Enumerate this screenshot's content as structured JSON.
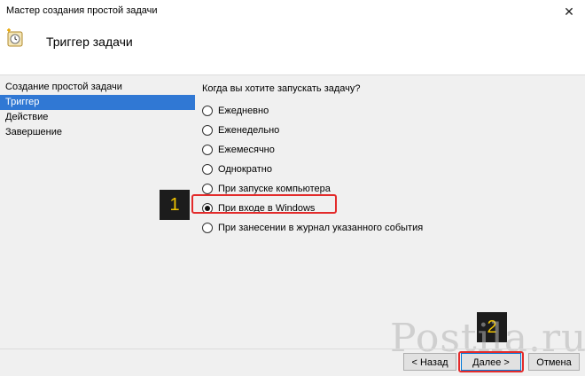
{
  "window": {
    "title": "Мастер создания простой задачи"
  },
  "header": {
    "title": "Триггер задачи"
  },
  "sidebar": {
    "items": [
      {
        "label": "Создание простой задачи",
        "active": false
      },
      {
        "label": "Триггер",
        "active": true
      },
      {
        "label": "Действие",
        "active": false
      },
      {
        "label": "Завершение",
        "active": false
      }
    ]
  },
  "main": {
    "question": "Когда вы хотите запускать задачу?",
    "options": [
      {
        "label": "Ежедневно",
        "checked": false
      },
      {
        "label": "Еженедельно",
        "checked": false
      },
      {
        "label": "Ежемесячно",
        "checked": false
      },
      {
        "label": "Однократно",
        "checked": false
      },
      {
        "label": "При запуске компьютера",
        "checked": false
      },
      {
        "label": "При входе в Windows",
        "checked": true
      },
      {
        "label": "При занесении в журнал указанного события",
        "checked": false
      }
    ]
  },
  "annotations": {
    "badge1": "1",
    "badge2": "2"
  },
  "buttons": {
    "back": "< Назад",
    "next": "Далее >",
    "cancel": "Отмена"
  },
  "watermark": {
    "text": "Postila.ru"
  },
  "colors": {
    "selection": "#3078d4",
    "highlight": "#e32b2b",
    "badge_bg": "#1c1c1c",
    "badge_fg": "#f2c400"
  }
}
